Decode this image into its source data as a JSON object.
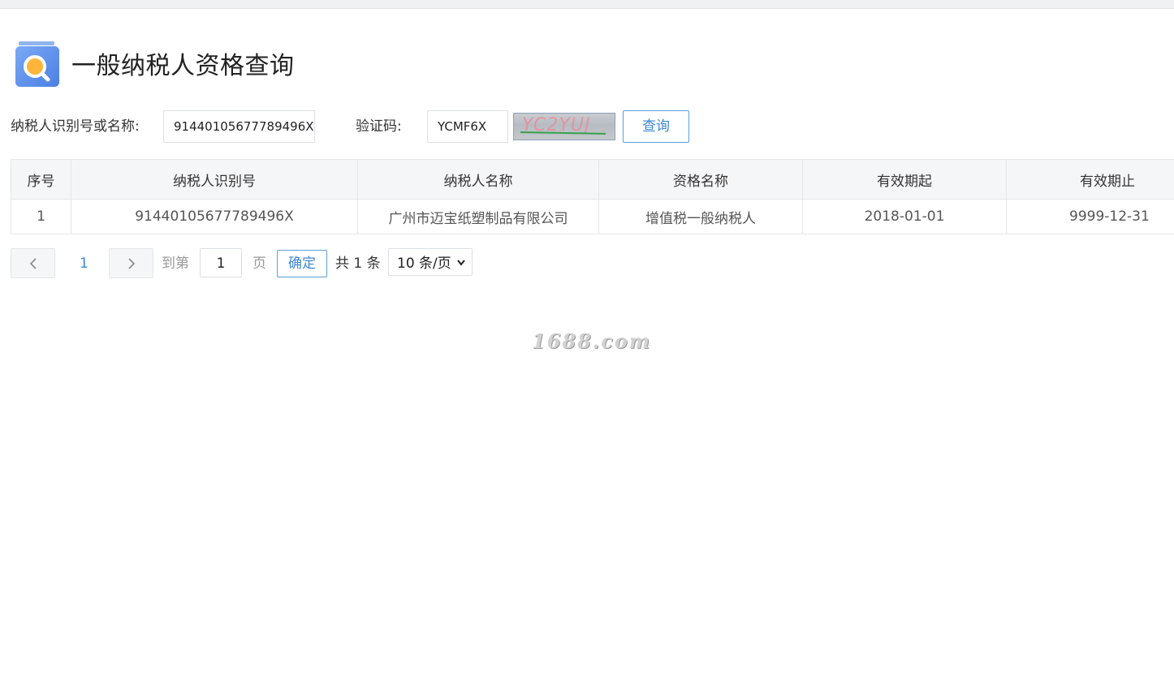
{
  "header": {
    "title": "一般纳税人资格查询",
    "logo_icon": "search-document-icon"
  },
  "search": {
    "taxpayer_label": "纳税人识别号或名称:",
    "taxpayer_value": "91440105677789496X",
    "captcha_label": "验证码:",
    "captcha_value": "YCMF6X",
    "captcha_image_text": "YC2YUJ",
    "query_button": "查询"
  },
  "table": {
    "columns": [
      "序号",
      "纳税人识别号",
      "纳税人名称",
      "资格名称",
      "有效期起",
      "有效期止"
    ],
    "rows": [
      [
        "1",
        "91440105677789496X",
        "广州市迈宝纸塑制品有限公司",
        "增值税一般纳税人",
        "2018-01-01",
        "9999-12-31"
      ]
    ]
  },
  "pagination": {
    "current_page": "1",
    "goto_label": "到第",
    "goto_value": "1",
    "page_unit": "页",
    "confirm_button": "确定",
    "total_text": "共 1 条",
    "page_size": "10 条/页"
  },
  "watermark": "1688.com",
  "colors": {
    "accent": "#3d88d4",
    "header_bg": "#f5f6f8",
    "border": "#e4e6ea"
  }
}
